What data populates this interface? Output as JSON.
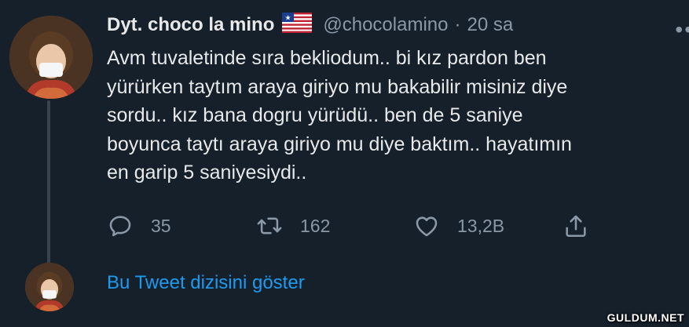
{
  "tweet": {
    "display_name": "Dyt. choco la mino",
    "handle": "@chocolamino",
    "separator": "·",
    "time": "20 sa",
    "flag_icon": "liberia-flag-icon",
    "text_lines": [
      "Avm tuvaletinde sıra bekliodum.. bi kız pardon ben",
      "yürürken taytım araya giriyo mu bakabilir misiniz diye",
      "sordu.. kız bana dogru yürüdü.. ben de 5 saniye",
      "boyunca taytı araya giriyo mu diye baktım..  hayatımın",
      "en garip 5 saniyesiydi.."
    ],
    "stats": {
      "replies": "35",
      "retweets": "162",
      "likes": "13,2B"
    }
  },
  "thread": {
    "show_label": "Bu Tweet dizisini göster"
  },
  "watermark": "GULDUM.NET",
  "colors": {
    "background": "#15202b",
    "text": "#e7e9ea",
    "muted": "#8b98a5",
    "link": "#1d9bf0",
    "line": "#38444d"
  }
}
